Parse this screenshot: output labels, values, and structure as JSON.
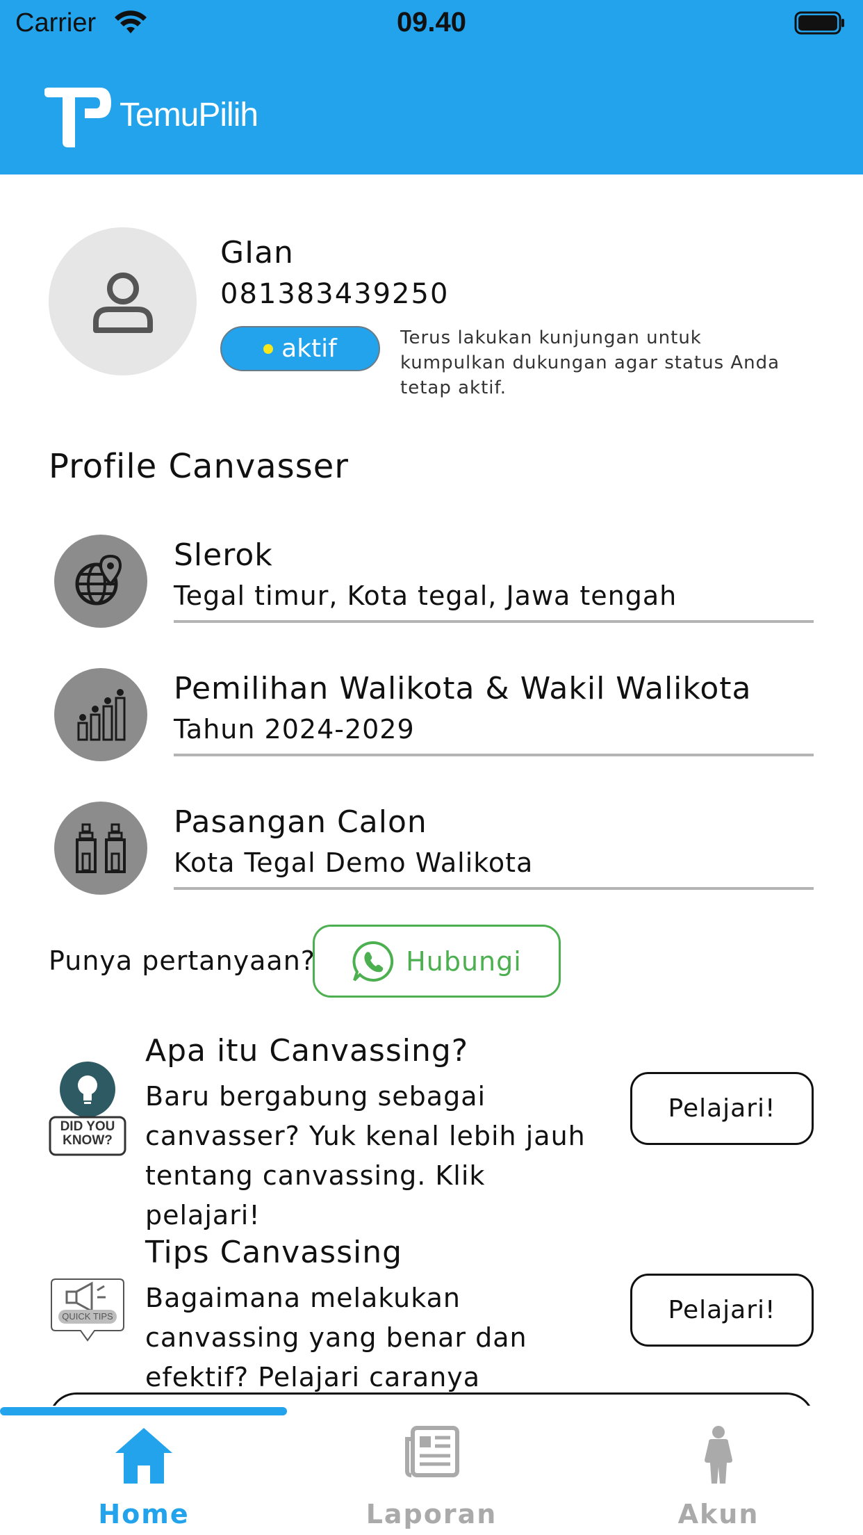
{
  "status_bar": {
    "carrier": "Carrier",
    "time": "09.40"
  },
  "app": {
    "logo_text": "TemuPilih",
    "brand_color": "#22a3ec"
  },
  "profile": {
    "name": "GIan",
    "phone": "081383439250",
    "status": "aktif",
    "status_note": "Terus lakukan kunjungan untuk kumpulkan dukungan agar status Anda tetap aktif."
  },
  "section": {
    "title": "Profile Canvasser"
  },
  "info_rows": [
    {
      "icon": "globe-location-icon",
      "title": "Slerok",
      "subtitle": "Tegal timur, Kota tegal, Jawa tengah"
    },
    {
      "icon": "growth-chart-icon",
      "title": "Pemilihan Walikota & Wakil Walikota",
      "subtitle": "Tahun 2024-2029"
    },
    {
      "icon": "candidates-icon",
      "title": "Pasangan Calon",
      "subtitle": "Kota Tegal Demo Walikota"
    }
  ],
  "contact": {
    "question": "Punya pertanyaan?",
    "button_label": "Hubungi",
    "button_color": "#4caf50"
  },
  "learn_cards": [
    {
      "thumb_text": "DID YOU KNOW?",
      "title": "Apa itu Canvassing?",
      "description": "Baru bergabung sebagai canvasser? Yuk kenal lebih jauh tentang canvassing. Klik pelajari!",
      "button_label": "Pelajari!"
    },
    {
      "thumb_text": "QUICK TIPS",
      "title": "Tips Canvassing",
      "description": "Bagaimana melakukan canvassing yang benar dan efektif? Pelajari caranya sekarang!",
      "button_label": "Pelajari!"
    }
  ],
  "bottom_nav": [
    {
      "label": "Home",
      "icon": "home-icon",
      "active": true
    },
    {
      "label": "Laporan",
      "icon": "newspaper-icon",
      "active": false
    },
    {
      "label": "Akun",
      "icon": "person-icon",
      "active": false
    }
  ]
}
